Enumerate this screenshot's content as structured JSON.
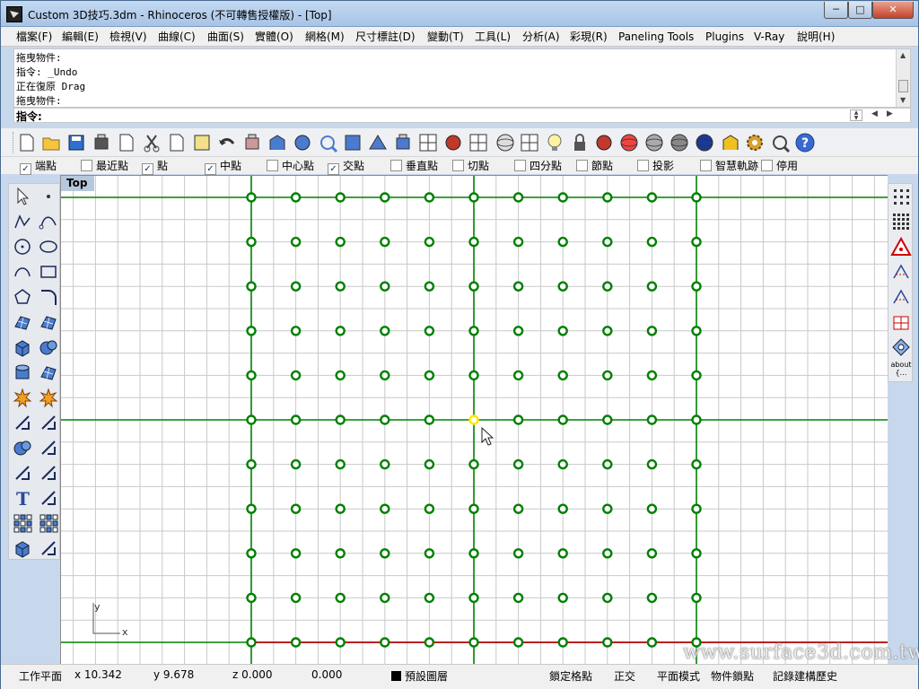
{
  "window": {
    "title": "Custom 3D技巧.3dm - Rhinoceros (不可轉售授權版) - [Top]",
    "buttons": {
      "minimize": "─",
      "maximize": "□",
      "close": "✕"
    }
  },
  "menu": [
    "檔案(F)",
    "編輯(E)",
    "檢視(V)",
    "曲線(C)",
    "曲面(S)",
    "實體(O)",
    "網格(M)",
    "尺寸標註(D)",
    "變動(T)",
    "工具(L)",
    "分析(A)",
    "彩現(R)",
    "Paneling Tools",
    "Plugins",
    "V-Ray",
    "說明(H)"
  ],
  "command_history": [
    "拖曳物件:",
    "指令: _Undo",
    "正在復原 Drag",
    "拖曳物件:"
  ],
  "command_prompt": "指令:",
  "toolbar_icons": [
    "new-file-icon",
    "open-file-icon",
    "save-icon",
    "print-icon",
    "import-icon",
    "cut-icon",
    "copy-icon",
    "paste-icon",
    "undo-icon",
    "pan-hand-icon",
    "rotate-view-icon",
    "zoom-icon",
    "zoom-window-icon",
    "zoom-extents-icon",
    "zoom-selected-icon",
    "undo-view-icon",
    "four-viewports-icon",
    "car-icon",
    "grid-snap-icon",
    "target-icon",
    "points-icon",
    "light-bulb-icon",
    "lock-icon",
    "layer-icon",
    "color-wheel-icon",
    "wireframe-sphere-icon",
    "shaded-sphere-icon",
    "render-sphere-icon",
    "material-icon",
    "gear-icon",
    "dimension-icon",
    "help-icon"
  ],
  "osnaps": [
    {
      "label": "端點",
      "checked": true
    },
    {
      "label": "最近點",
      "checked": false
    },
    {
      "label": "點",
      "checked": true
    },
    {
      "label": "中點",
      "checked": true
    },
    {
      "label": "中心點",
      "checked": false
    },
    {
      "label": "交點",
      "checked": true
    },
    {
      "label": "垂直點",
      "checked": false
    },
    {
      "label": "切點",
      "checked": false
    },
    {
      "label": "四分點",
      "checked": false
    },
    {
      "label": "節點",
      "checked": false
    },
    {
      "label": "投影",
      "checked": false
    },
    {
      "label": "智慧軌跡",
      "checked": false
    },
    {
      "label": "停用",
      "checked": false
    }
  ],
  "left_tools": [
    "select-arrow-icon",
    "point-icon",
    "polyline-icon",
    "curve-icon",
    "circle-icon",
    "ellipse-icon",
    "arc-icon",
    "rectangle-icon",
    "polygon-icon",
    "fillet-icon",
    "surface-icon",
    "loft-icon",
    "box-icon",
    "sphere-icon",
    "cylinder-icon",
    "extrude-icon",
    "explode-icon",
    "split-icon",
    "move-icon",
    "align-icon",
    "boolean-icon",
    "array-icon",
    "curve-from-object-icon",
    "offset-icon",
    "text-icon",
    "scale-icon",
    "group-icon",
    "array-linear-icon",
    "solid-tools-icon",
    "dimension-ruler-icon"
  ],
  "right_tools": [
    "point-grid-icon",
    "dense-grid-icon",
    "triangle-warning-icon",
    "analysis-icon",
    "mesh-icon",
    "panel-icon",
    "diamond-icon"
  ],
  "right_about_label": "about",
  "viewport": {
    "name": "Top",
    "axis_y": "y",
    "axis_x": "x",
    "grid_color": "#c9c9c9",
    "major_line_color": "#008000",
    "x_axis_color": "#b00000",
    "point_color": "#008000",
    "highlight_color": "#ffe600",
    "points_cols": 11,
    "points_rows": 11,
    "highlight_point": {
      "col": 5,
      "row": 5
    }
  },
  "status": {
    "cplane": "工作平面",
    "x": "x 10.342",
    "y": "y 9.678",
    "z": "z 0.000",
    "dist": "0.000",
    "layer": "預設圖層",
    "grid_snap": "鎖定格點",
    "ortho": "正交",
    "planar": "平面模式",
    "osnap": "物件鎖點",
    "history": "記錄建構歷史"
  },
  "watermark": "www.surface3d.com.tw"
}
